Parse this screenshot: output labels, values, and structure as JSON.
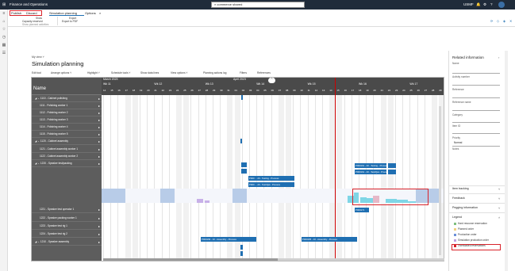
{
  "app": {
    "title": "Finance and Operations",
    "search_text": "commerce shared",
    "company": "USMF"
  },
  "ribbon": {
    "tabs": [
      "Publish",
      "Discard",
      "Simulation planning",
      "Options"
    ],
    "groups": [
      {
        "title": "Show",
        "items": [
          "Capacity reserved",
          "Show planned activities"
        ]
      },
      {
        "title": "Export",
        "items": [
          "Export to PDF"
        ]
      }
    ]
  },
  "page": {
    "view_label": "My view ˅",
    "title": "Simulation planning"
  },
  "toolbar": [
    "Edit tool",
    "Arrange options ˅",
    "Highlight ˅",
    "Schedule tools ˅",
    "Show data lines",
    "View options ˅",
    "Planning actions log",
    "Filters",
    "References"
  ],
  "gantt": {
    "name_header": "Name",
    "months": [
      "March 2023",
      "April 2023"
    ],
    "weeks": [
      "Wk 11",
      "Wk 12",
      "Wk 13",
      "Wk 14",
      "Wk 15",
      "Wk 16",
      "Wk 17"
    ],
    "days": [
      "14",
      "15",
      "16",
      "17",
      "18",
      "19",
      "20",
      "21",
      "22",
      "23",
      "24",
      "25",
      "26",
      "27",
      "28",
      "29",
      "30",
      "31",
      "01",
      "02",
      "03",
      "04",
      "05",
      "06",
      "07",
      "08",
      "09",
      "10",
      "11",
      "12",
      "13",
      "14",
      "15",
      "16",
      "17",
      "18",
      "19",
      "20",
      "21",
      "22",
      "23",
      "24",
      "25",
      "26",
      "27",
      "28",
      "29"
    ],
    "rows": [
      {
        "label": "1110 - Cabinet polishing",
        "indent": 0
      },
      {
        "label": "1111 - Polishing worker 1",
        "indent": 1
      },
      {
        "label": "1112 - Polishing worker 2",
        "indent": 1
      },
      {
        "label": "1113 - Polishing worker 3",
        "indent": 1
      },
      {
        "label": "1114 - Polishing worker 4",
        "indent": 1
      },
      {
        "label": "1115 - Polishing worker 5",
        "indent": 1
      },
      {
        "label": "1120 - Cabinet assembly",
        "indent": 0
      },
      {
        "label": "1121 - Cabinet assembly worker 1",
        "indent": 1
      },
      {
        "label": "1122 - Cabinet assembly worker 2",
        "indent": 1
      },
      {
        "label": "1220 - Speaker test/packing",
        "indent": 0
      },
      {
        "label": "1221 - Speaker test operator 1",
        "indent": 1
      },
      {
        "label": "1222 - Speaker packing worker 1",
        "indent": 1
      },
      {
        "label": "1223 - Speaker test rig 1",
        "indent": 1
      },
      {
        "label": "1224 - Speaker test rig 2",
        "indent": 1
      },
      {
        "label": "1210 - Speaker assembly",
        "indent": 0
      }
    ],
    "bars": [
      "P000",
      "P000",
      "P000 ...",
      "P000 ...",
      "P000 ...",
      "P000 ... 20 - Testing - Process",
      "P000 ... 20 - Test/Qat - Process",
      "P000161 - 20 - Testing - Process",
      "P000161 - 20 - Test/Qat - Process",
      "P000",
      "P000",
      "P000171",
      "P000169 - 10 - Assembly - Process",
      "P000165 - 10 - Assembly - Process",
      "P000",
      "P000"
    ]
  },
  "related": {
    "title": "Related information",
    "fields": [
      "Name",
      "Activity number",
      "Reference",
      "Reference name",
      "Category",
      "Item ID",
      "Priority",
      "Notes"
    ],
    "priority_value": "Normal",
    "sections": [
      "Item tracking",
      "Feedback",
      "Pegging information"
    ],
    "legend_title": "Legend",
    "legend": [
      {
        "label": "Hard resource reservation",
        "color": "#7fbf7f"
      },
      {
        "label": "Planned order",
        "color": "#f0d080"
      },
      {
        "label": "Production order",
        "color": "#6a8fd8"
      },
      {
        "label": "Simulation production order",
        "color": "#c0a0e0"
      },
      {
        "label": "Overloaded reservations",
        "color": "#d8232a"
      }
    ]
  }
}
